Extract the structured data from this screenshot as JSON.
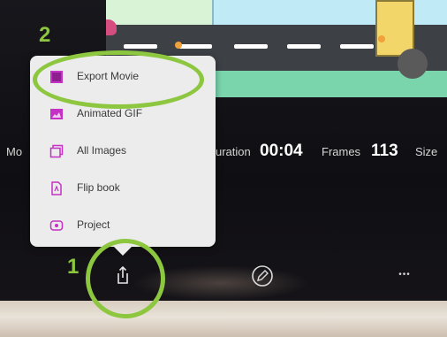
{
  "stats": {
    "mode_label": "Mo",
    "duration_label": "uration",
    "duration_value": "00:04",
    "frames_label": "Frames",
    "frames_value": "113",
    "size_label": "Size"
  },
  "share_menu": {
    "items": [
      {
        "label": "Export Movie",
        "icon": "film-icon"
      },
      {
        "label": "Animated GIF",
        "icon": "image-icon"
      },
      {
        "label": "All Images",
        "icon": "stacked-images-icon"
      },
      {
        "label": "Flip book",
        "icon": "document-icon"
      },
      {
        "label": "Project",
        "icon": "project-icon"
      }
    ]
  },
  "toolbar": {
    "share_icon": "share-icon",
    "edit_icon": "pencil-icon",
    "more_icon": "more-icon",
    "more_text": "•••"
  },
  "annotations": {
    "step1": "1",
    "step2": "2"
  },
  "colors": {
    "highlight": "#8dc63f",
    "menu_icon": "#c431c4",
    "menu_bg": "#ececec"
  }
}
